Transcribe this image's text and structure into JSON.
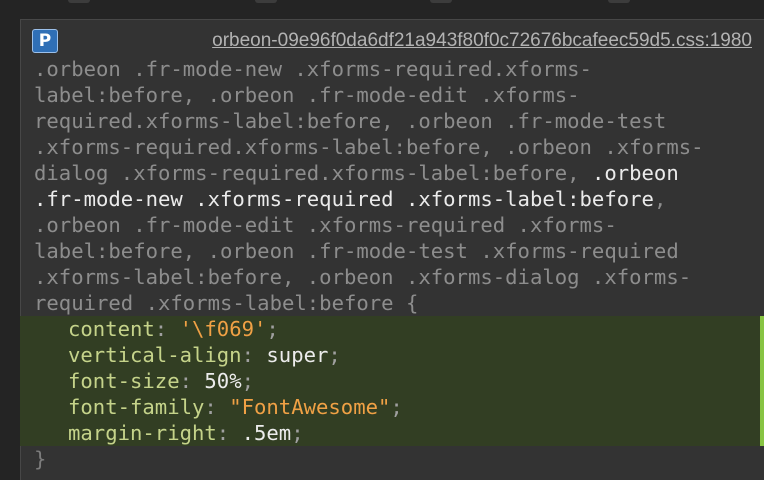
{
  "rule": {
    "origin_badge": "P",
    "source": "orbeon-09e96f0da6df21a943f80f0c72676bcafeec59d5.css:1980",
    "selector_lines": [
      {
        "dim": ".orbeon .fr-mode-new .xforms-required.xforms-",
        "match": "",
        "tail": ""
      },
      {
        "dim": "label:before, .orbeon .fr-mode-edit .xforms-",
        "match": "",
        "tail": ""
      },
      {
        "dim": "required.xforms-label:before, .orbeon .fr-mode-test",
        "match": "",
        "tail": ""
      },
      {
        "dim": ".xforms-required.xforms-label:before, .orbeon .xforms-",
        "match": "",
        "tail": ""
      },
      {
        "dim": "dialog .xforms-required.xforms-label:before, ",
        "match": ".orbeon",
        "tail": ""
      },
      {
        "dim": "",
        "match": ".fr-mode-new .xforms-required .xforms-label:before",
        "tail": ","
      },
      {
        "dim": ".orbeon .fr-mode-edit .xforms-required .xforms-",
        "match": "",
        "tail": ""
      },
      {
        "dim": "label:before, .orbeon .fr-mode-test .xforms-required",
        "match": "",
        "tail": ""
      },
      {
        "dim": ".xforms-label:before, .orbeon .xforms-dialog .xforms-",
        "match": "",
        "tail": ""
      },
      {
        "dim": "required .xforms-label:before ",
        "match": "",
        "tail": "{"
      }
    ],
    "declarations": [
      {
        "property": "content",
        "value": "'\\f069'",
        "kind": "string"
      },
      {
        "property": "vertical-align",
        "value": "super",
        "kind": "plain"
      },
      {
        "property": "font-size",
        "value": "50%",
        "kind": "plain"
      },
      {
        "property": "font-family",
        "value": "\"FontAwesome\"",
        "kind": "string"
      },
      {
        "property": "margin-right",
        "value": ".5em",
        "kind": "plain"
      }
    ],
    "close": "}"
  },
  "colors": {
    "panel_bg": "#333333",
    "matched_decl_bg": "#323e23",
    "matched_bar": "#87c442",
    "property": "#c5d38a",
    "string_value": "#f0a145",
    "selector_dim": "#8d8d8d",
    "selector_match": "#ebebeb"
  }
}
